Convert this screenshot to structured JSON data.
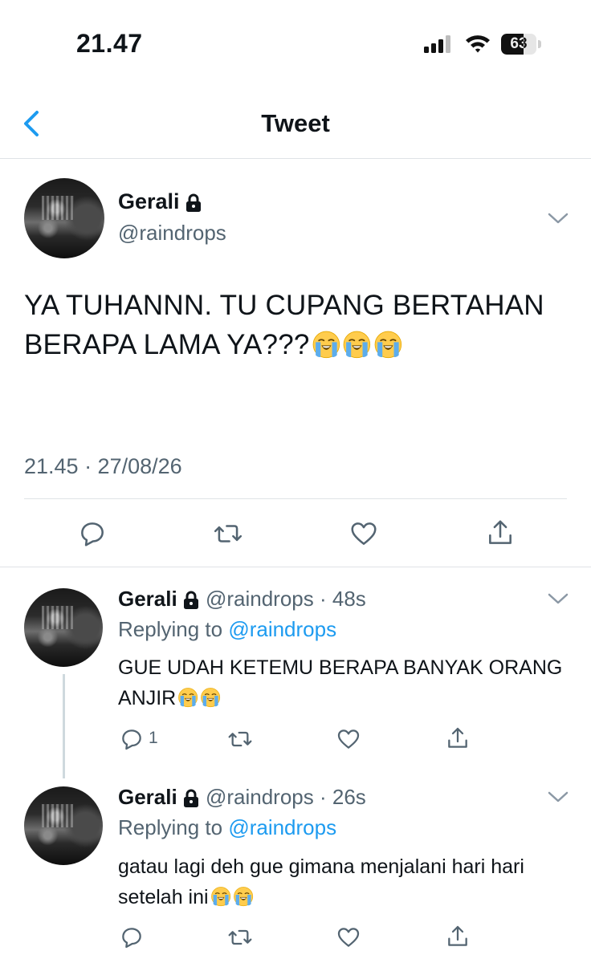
{
  "status_bar": {
    "time": "21.47",
    "battery": "63",
    "battery_level": 0.63
  },
  "nav": {
    "title": "Tweet"
  },
  "main_tweet": {
    "name": "Gerali",
    "handle": "@raindrops",
    "text": "YA TUHANNN. TU CUPANG BERTAHAN BERAPA LAMA YA???",
    "emoji_after_text": 3,
    "timestamp": "21.45 · 27/08/26"
  },
  "replies": [
    {
      "name": "Gerali",
      "handle": "@raindrops",
      "time": "48s",
      "replying_label": "Replying to",
      "replying_to": "@raindrops",
      "text": "GUE UDAH KETEMU BERAPA BANYAK ORANG ANJIR",
      "reply_count": "1"
    },
    {
      "name": "Gerali",
      "handle": "@raindrops",
      "time": "26s",
      "replying_label": "Replying to",
      "replying_to": "@raindrops",
      "text": "gatau lagi deh gue gimana menjalani hari hari setelah ini",
      "reply_count": ""
    }
  ],
  "icons": {
    "back": "chevron-left-icon",
    "lock": "lock-icon",
    "more": "chevron-down-icon",
    "reply": "comment-icon",
    "retweet": "retweet-icon",
    "like": "heart-icon",
    "share": "share-icon",
    "emoji": "loudly-crying-face-emoji"
  },
  "colors": {
    "accent": "#1d9bf0",
    "secondary_text": "#536471",
    "divider": "#dfe3e6"
  }
}
